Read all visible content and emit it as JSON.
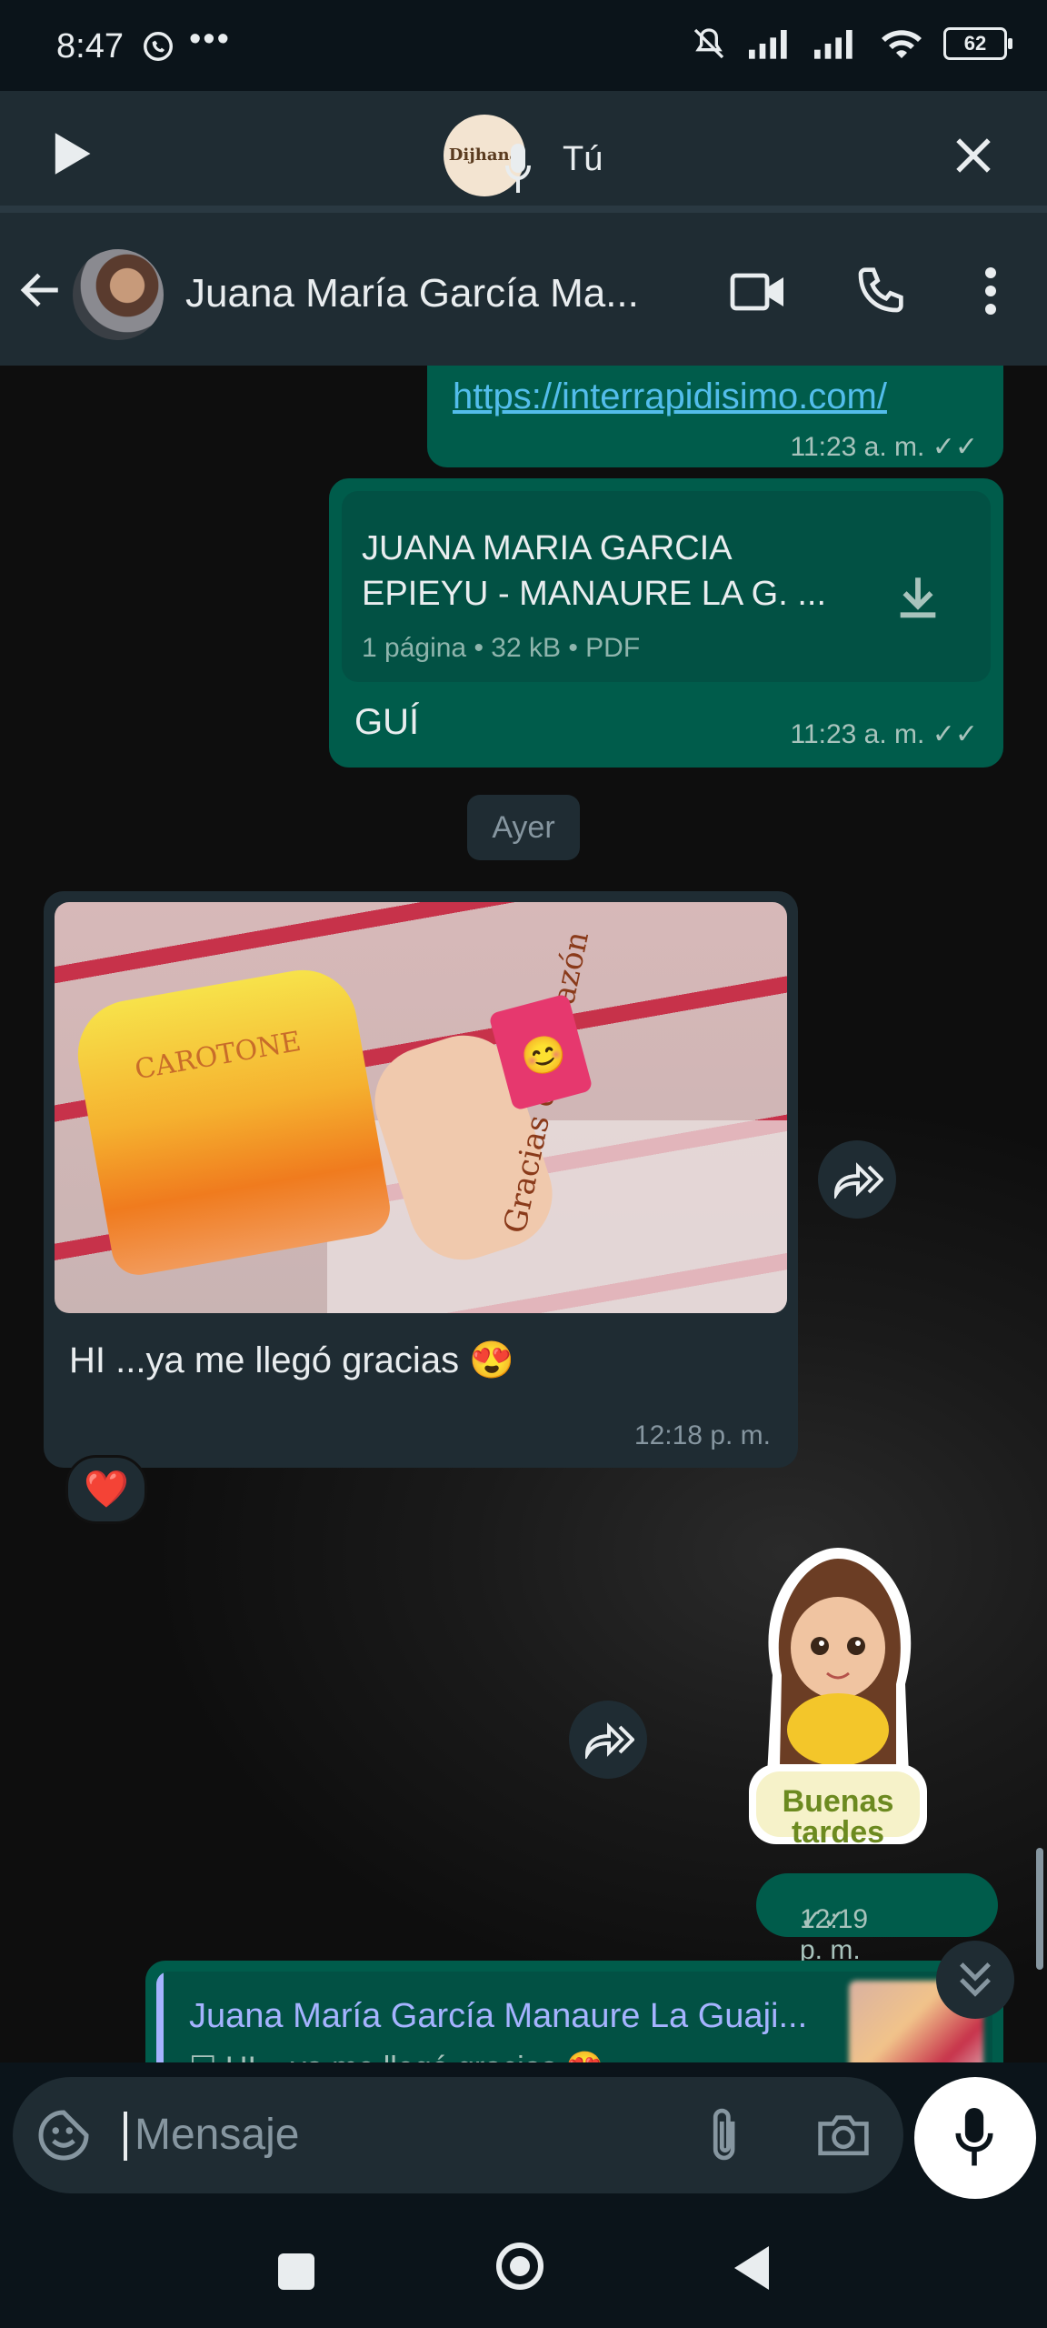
{
  "status_bar": {
    "time": "8:47",
    "dots": "•••",
    "battery": "62",
    "icons": [
      "whatsapp-icon",
      "mute-icon",
      "signal-icon",
      "signal-icon",
      "wifi-icon",
      "battery-icon"
    ]
  },
  "voice_bar": {
    "avatar_text": "Dijhana",
    "label": "Tú",
    "icons": [
      "play-icon",
      "mic-icon",
      "close-icon"
    ]
  },
  "header": {
    "contact_name": "Juana María  García Ma...",
    "icons": [
      "back-arrow-icon",
      "video-call-icon",
      "phone-icon",
      "more-vert-icon"
    ]
  },
  "messages": {
    "link": {
      "url": "https://interrapidisimo.com/",
      "time": "11:23 a. m."
    },
    "pdf": {
      "title_line1": "JUANA MARIA GARCIA",
      "title_line2": "EPIEYU - MANAURE LA G. ...",
      "meta": "1 página • 32 kB • PDF",
      "caption": "GUÍ",
      "time": "11:23 a. m."
    },
    "date_divider": "Ayer",
    "photo": {
      "jar_label": "CAROTONE",
      "tag_text": "Gracias de Corazón",
      "caption": "HI ...ya me llegó gracias 😍",
      "time": "12:18 p. m.",
      "reaction": "❤️"
    },
    "sticker": {
      "text_line1": "Buenas",
      "text_line2": "tardes",
      "time": "12:19 p. m."
    },
    "reply": {
      "name": "Juana María  García Manaure La Guaji...",
      "text": "☐ HI ...ya me llegó gracias 😍"
    }
  },
  "composer": {
    "placeholder": "Mensaje",
    "icons": [
      "emoji-sticker-icon",
      "attach-icon",
      "camera-icon",
      "mic-icon"
    ]
  },
  "colors": {
    "background": "#0b141a",
    "bar": "#1f2c33",
    "outgoing": "#005c4b",
    "incoming": "#1f2c33",
    "link": "#53bdeb",
    "reply_name": "#a5b3ff"
  }
}
